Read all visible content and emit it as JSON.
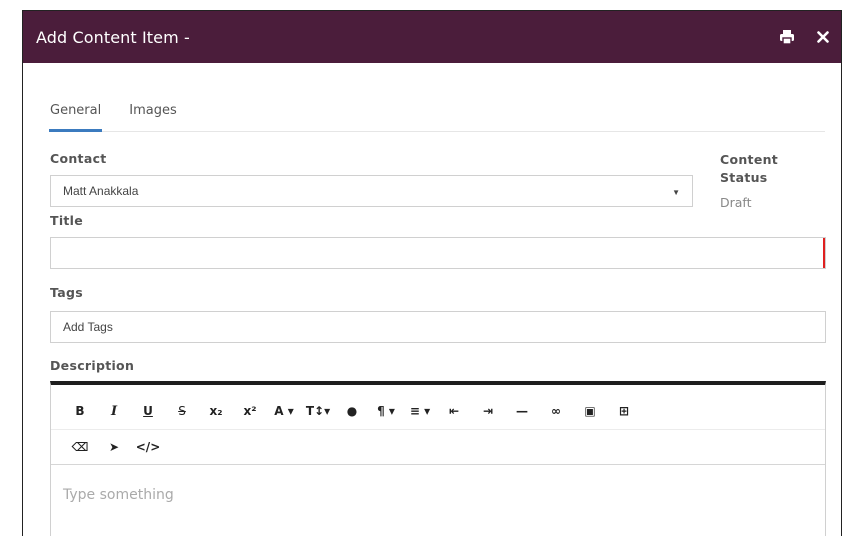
{
  "modal": {
    "title": "Add Content Item -",
    "print_icon": "print-icon",
    "close_icon": "close-icon"
  },
  "tabs": [
    {
      "label": "General",
      "active": true
    },
    {
      "label": "Images",
      "active": false
    }
  ],
  "form": {
    "contact_label": "Contact",
    "contact_value": "Matt Anakkala",
    "title_label": "Title",
    "title_value": "",
    "tags_label": "Tags",
    "tags_placeholder": "Add Tags",
    "description_label": "Description",
    "content_status_label": "Content Status",
    "content_status_value": "Draft"
  },
  "editor": {
    "placeholder": "Type something",
    "toolbar_row1": [
      {
        "name": "bold",
        "glyph": "B"
      },
      {
        "name": "italic",
        "glyph": "I"
      },
      {
        "name": "underline",
        "glyph": "U"
      },
      {
        "name": "strikethrough",
        "glyph": "S"
      },
      {
        "name": "subscript",
        "glyph": "x₂"
      },
      {
        "name": "superscript",
        "glyph": "x²"
      },
      {
        "name": "font-family",
        "glyph": "A ▾"
      },
      {
        "name": "font-size",
        "glyph": "T↕ ▾"
      },
      {
        "name": "color",
        "glyph": "●"
      },
      {
        "name": "paragraph-format",
        "glyph": "¶ ▾"
      },
      {
        "name": "align",
        "glyph": "≡ ▾"
      },
      {
        "name": "outdent",
        "glyph": "⇤"
      },
      {
        "name": "indent",
        "glyph": "⇥"
      },
      {
        "name": "horizontal-line",
        "glyph": "—"
      },
      {
        "name": "insert-link",
        "glyph": "🔗"
      },
      {
        "name": "insert-image",
        "glyph": "▣"
      },
      {
        "name": "insert-table",
        "glyph": "⊞"
      }
    ],
    "toolbar_row2": [
      {
        "name": "clear-formatting",
        "glyph": "⌫"
      },
      {
        "name": "select-all",
        "glyph": "➤"
      },
      {
        "name": "html-view",
        "glyph": "</>"
      }
    ]
  },
  "colors": {
    "header_bg": "#4b1d3b",
    "tab_active": "#3b7bbf",
    "required": "#e02020"
  }
}
